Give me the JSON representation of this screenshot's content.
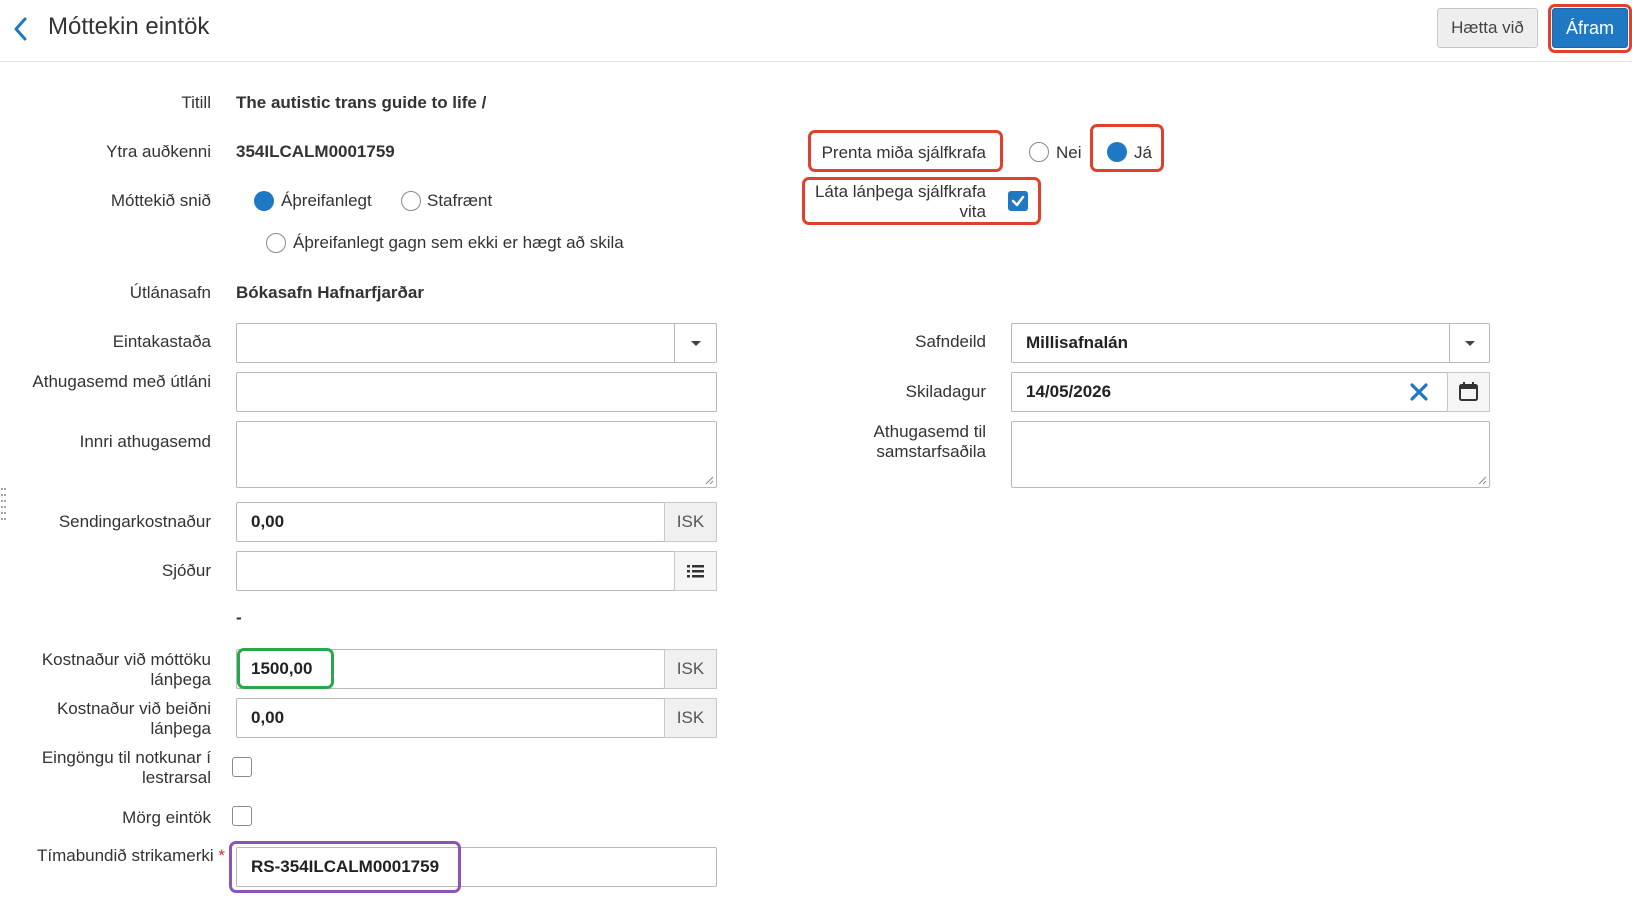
{
  "header": {
    "title": "Móttekin eintök",
    "cancel_label": "Hætta við",
    "next_label": "Áfram"
  },
  "fields": {
    "title_label": "Titill",
    "title_value": "The autistic trans guide to life /",
    "external_id_label": "Ytra auðkenni",
    "external_id_value": "354ILCALM0001759",
    "format_label": "Móttekið snið",
    "format_options": [
      "Áþreifanlegt",
      "Stafrænt",
      "Áþreifanlegt gagn sem ekki er hægt að skila"
    ],
    "format_selected": "Áþreifanlegt",
    "lending_library_label": "Útlánasafn",
    "lending_library_value": "Bókasafn Hafnarfjarðar",
    "item_status_label": "Eintakastaða",
    "item_status_value": "",
    "loan_note_label": "Athugasemd með útláni",
    "loan_note_value": "",
    "internal_note_label": "Innri athugasemd",
    "shipping_cost_label": "Sendingarkostnaður",
    "shipping_cost_value": "0,00",
    "currency": "ISK",
    "fund_label": "Sjóður",
    "fund_value": "",
    "fund_dash": "-",
    "receive_fee_label": "Kostnaður við móttöku lánþega",
    "receive_fee_value": "1500,00",
    "request_fee_label": "Kostnaður við beiðni lánþega",
    "request_fee_value": "0,00",
    "reading_room_label": "Eingöngu til notkunar í lestrarsal",
    "reading_room_checked": false,
    "multi_volume_label": "Mörg eintök",
    "multi_volume_checked": false,
    "temp_barcode_label": "Tímabundið strikamerki",
    "temp_barcode_required": "*",
    "temp_barcode_value": "RS-354ILCALM0001759"
  },
  "right": {
    "print_label": "Prenta miða sjálfkrafa",
    "print_no": "Nei",
    "print_yes": "Já",
    "print_selected": "Já",
    "notify_label": "Láta lánþega sjálfkrafa vita",
    "notify_checked": true,
    "department_label": "Safndeild",
    "department_value": "Millisafnalán",
    "due_date_label": "Skiladagur",
    "due_date_value": "14/05/2026",
    "partner_note_label": "Athugasemd til samstarfsaðila"
  },
  "colors": {
    "primary": "#1f78c4",
    "highlight_red": "#e0402e",
    "highlight_green": "#27a84b",
    "highlight_purple": "#8c55b5"
  }
}
